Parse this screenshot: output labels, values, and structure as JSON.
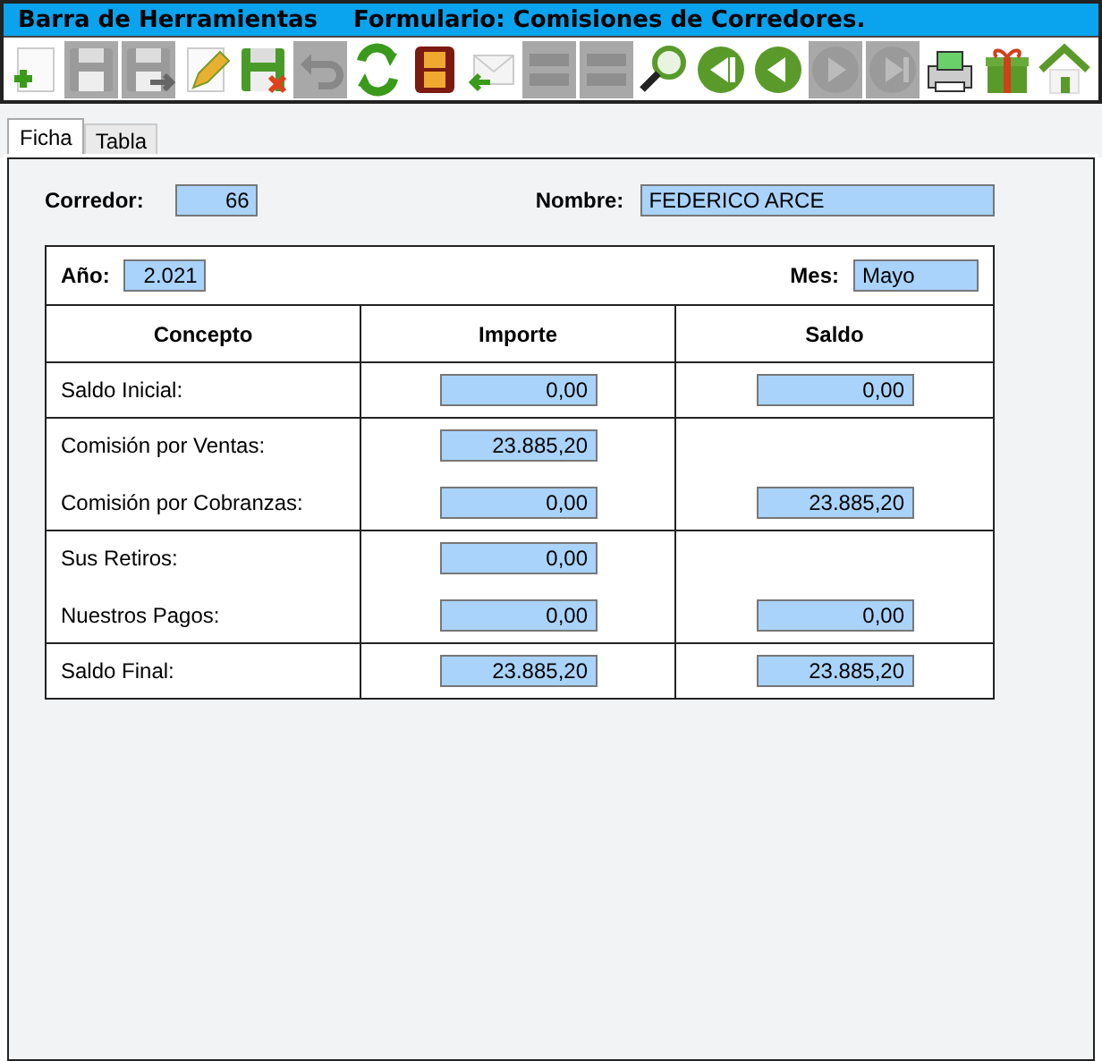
{
  "title_bar": {
    "title": "Barra de Herramientas",
    "subtitle": "Formulario: Comisiones de Corredores."
  },
  "toolbar": [
    {
      "kind": "new",
      "disabled": false
    },
    {
      "kind": "save",
      "disabled": true
    },
    {
      "kind": "save-as",
      "disabled": true
    },
    {
      "kind": "edit",
      "disabled": false
    },
    {
      "kind": "discard",
      "disabled": false
    },
    {
      "kind": "undo",
      "disabled": true
    },
    {
      "kind": "refresh",
      "disabled": false
    },
    {
      "kind": "film",
      "disabled": false
    },
    {
      "kind": "import",
      "disabled": false
    },
    {
      "kind": "list",
      "disabled": true
    },
    {
      "kind": "list",
      "disabled": true
    },
    {
      "kind": "search",
      "disabled": false
    },
    {
      "kind": "first",
      "disabled": false
    },
    {
      "kind": "prev",
      "disabled": false
    },
    {
      "kind": "next",
      "disabled": true
    },
    {
      "kind": "last",
      "disabled": true
    },
    {
      "kind": "print",
      "disabled": false
    },
    {
      "kind": "gift",
      "disabled": false
    },
    {
      "kind": "home",
      "disabled": false
    }
  ],
  "tabs": [
    {
      "label": "Ficha",
      "selected": true
    },
    {
      "label": "Tabla",
      "selected": false
    }
  ],
  "corredor": {
    "label": "Corredor:",
    "value": "66"
  },
  "nombre": {
    "label": "Nombre:",
    "value": "FEDERICO ARCE"
  },
  "anio": {
    "label": "Año:",
    "value": "2.021"
  },
  "mes": {
    "label": "Mes:",
    "value": "Mayo"
  },
  "table": {
    "columns": [
      "Concepto",
      "Importe",
      "Saldo"
    ],
    "groups": [
      {
        "rows": [
          {
            "concepto": "Saldo Inicial:",
            "importe": "0,00",
            "saldo": "0,00"
          }
        ]
      },
      {
        "rows": [
          {
            "concepto": "Comisión por Ventas:",
            "importe": "23.885,20"
          },
          {
            "concepto": "Comisión por Cobranzas:",
            "importe": "0,00",
            "saldo": "23.885,20"
          }
        ]
      },
      {
        "rows": [
          {
            "concepto": "Sus Retiros:",
            "importe": "0,00"
          },
          {
            "concepto": "Nuestros Pagos:",
            "importe": "0,00",
            "saldo": "0,00"
          }
        ]
      },
      {
        "rows": [
          {
            "concepto": "Saldo Final:",
            "importe": "23.885,20",
            "saldo": "23.885,20"
          }
        ]
      }
    ]
  }
}
